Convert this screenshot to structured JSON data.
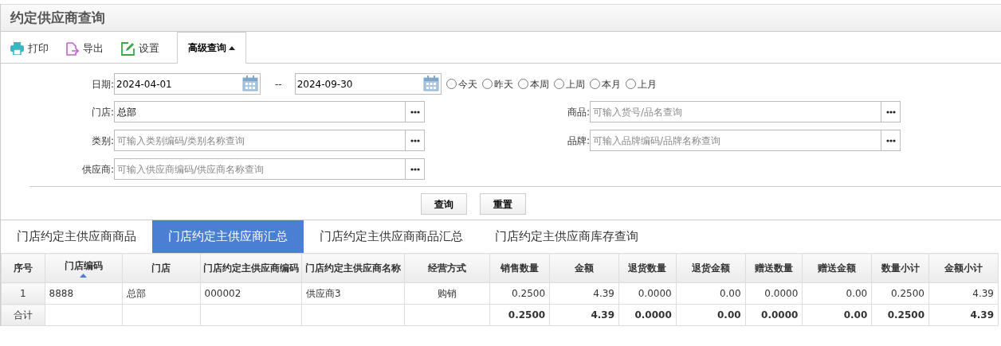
{
  "title": "约定供应商查询",
  "toolbar": [
    {
      "kind": "print",
      "label": "打印"
    },
    {
      "kind": "export",
      "label": "导出"
    },
    {
      "kind": "settings",
      "label": "设置"
    }
  ],
  "advanced_toggle": {
    "label": "高级查询",
    "expanded": true
  },
  "date": {
    "label": "日期:",
    "from": "2024-04-01",
    "separator": "--",
    "to": "2024-09-30"
  },
  "date_presets": [
    {
      "label": "今天",
      "selected": false
    },
    {
      "label": "昨天",
      "selected": false
    },
    {
      "label": "本周",
      "selected": false
    },
    {
      "label": "上周",
      "selected": false
    },
    {
      "label": "本月",
      "selected": false
    },
    {
      "label": "上月",
      "selected": false
    }
  ],
  "fields": [
    {
      "label": "门店:",
      "value": "总部"
    },
    {
      "label": "商品:",
      "placeholder": "可输入货号/品名查询"
    },
    {
      "label": "类别:",
      "placeholder": "可输入类别编码/类别名称查询"
    },
    {
      "label": "品牌:",
      "placeholder": "可输入品牌编码/品牌名称查询"
    },
    {
      "label": "供应商:",
      "placeholder": "可输入供应商编码/供应商名称查询"
    }
  ],
  "buttons": [
    "查询",
    "重置"
  ],
  "tabs": [
    {
      "label": "门店约定主供应商商品",
      "selected": false
    },
    {
      "label": "门店约定主供应商汇总",
      "selected": true
    },
    {
      "label": "门店约定主供应商商品汇总",
      "selected": false
    },
    {
      "label": "门店约定主供应商库存查询",
      "selected": false
    }
  ],
  "table": {
    "columns": [
      {
        "label": "序号"
      },
      {
        "label": "门店编码",
        "sorted_ascending": true
      },
      {
        "label": "门店"
      },
      {
        "label": "门店约定主供应商编码"
      },
      {
        "label": "门店约定主供应商名称"
      },
      {
        "label": "经营方式"
      },
      {
        "label": "销售数量"
      },
      {
        "label": "金额"
      },
      {
        "label": "退货数量"
      },
      {
        "label": "退货金额"
      },
      {
        "label": "赠送数量"
      },
      {
        "label": "赠送金额"
      },
      {
        "label": "数量小计"
      },
      {
        "label": "金额小计"
      }
    ],
    "rows": [
      [
        "1",
        "8888",
        "总部",
        "000002",
        "供应商3",
        "购销",
        "0.2500",
        "4.39",
        "0.0000",
        "0.00",
        "0.0000",
        "0.00",
        "0.2500",
        "4.39"
      ]
    ],
    "totals": {
      "label": "合计",
      "values": [
        "0.2500",
        "4.39",
        "0.0000",
        "0.00",
        "0.0000",
        "0.00",
        "0.2500",
        "4.39"
      ]
    }
  }
}
